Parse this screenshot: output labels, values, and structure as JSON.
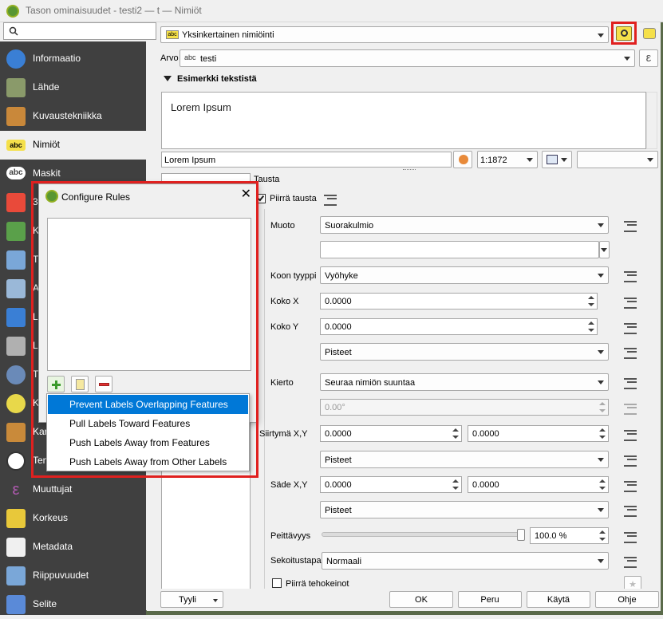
{
  "window": {
    "title": "Tason ominaisuudet - testi2 — t — Nimiöt"
  },
  "search": {
    "placeholder": ""
  },
  "sidebar": {
    "items": [
      {
        "label": "Informaatio",
        "icon": "info-icon"
      },
      {
        "label": "Lähde",
        "icon": "source-icon"
      },
      {
        "label": "Kuvaustekniikka",
        "icon": "symbology-icon"
      },
      {
        "label": "Nimiöt",
        "icon": "labels-icon"
      },
      {
        "label": "Maskit",
        "icon": "masks-icon"
      },
      {
        "label": "3",
        "icon": "3d-view-icon"
      },
      {
        "label": "K",
        "icon": "diagrams-icon"
      },
      {
        "label": "T",
        "icon": "fields-icon"
      },
      {
        "label": "A",
        "icon": "attributes-form-icon"
      },
      {
        "label": "L",
        "icon": "joins-icon"
      },
      {
        "label": "L",
        "icon": "auxiliary-storage-icon"
      },
      {
        "label": "T",
        "icon": "actions-icon"
      },
      {
        "label": "K",
        "icon": "display-icon"
      },
      {
        "label": "Kar",
        "icon": "rendering-icon"
      },
      {
        "label": "Ten",
        "icon": "temporal-icon"
      },
      {
        "label": "Muuttujat",
        "icon": "variables-icon"
      },
      {
        "label": "Korkeus",
        "icon": "elevation-icon"
      },
      {
        "label": "Metadata",
        "icon": "metadata-icon"
      },
      {
        "label": "Riippuvuudet",
        "icon": "dependencies-icon"
      },
      {
        "label": "Selite",
        "icon": "legend-icon"
      }
    ]
  },
  "labeling": {
    "mode": "Yksinkertainen nimiöinti",
    "mode_badge": "abc",
    "value_label": "Arvo",
    "value_badge": "abc",
    "value_field": "testi",
    "expression_symbol": "ε"
  },
  "preview": {
    "section_title": "Esimerkki tekstistä",
    "sample_text": "Lorem Ipsum",
    "sample_input": "Lorem Ipsum",
    "scale": "1:1872"
  },
  "background": {
    "section": "Tausta",
    "draw_label": "Piirrä tausta",
    "draw_checked": true,
    "shape_label": "Muoto",
    "shape_value": "Suorakulmio",
    "size_type_label": "Koon tyyppi",
    "size_type_value": "Vyöhyke",
    "size_x_label": "Koko X",
    "size_x_value": "0.0000",
    "size_y_label": "Koko Y",
    "size_y_value": "0.0000",
    "size_unit": "Pisteet",
    "rotation_label": "Kierto",
    "rotation_value": "Seuraa nimiön suuntaa",
    "rotation_angle": "0.00°",
    "offset_label": "Siirtymä X,Y",
    "offset_x": "0.0000",
    "offset_y": "0.0000",
    "offset_unit": "Pisteet",
    "radius_label": "Säde X,Y",
    "radius_x": "0.0000",
    "radius_y": "0.0000",
    "radius_unit": "Pisteet",
    "opacity_label": "Peittävyys",
    "opacity_value": "100.0 %",
    "opacity_fraction": 1.0,
    "blend_label": "Sekoitustapa",
    "blend_value": "Normaali",
    "effects_label": "Piirrä tehokeinot",
    "effects_checked": false
  },
  "dialog": {
    "title": "Configure Rules",
    "menu": [
      "Prevent Labels Overlapping Features",
      "Pull Labels Toward Features",
      "Push Labels Away from Features",
      "Push Labels Away from Other Labels"
    ],
    "selected_index": 0
  },
  "footer": {
    "style_label": "Tyyli",
    "ok_label": "OK",
    "cancel_label": "Peru",
    "apply_label": "Käytä",
    "help_label": "Ohje"
  },
  "colors": {
    "sidebar": "#404040",
    "highlight": "#e0201f",
    "selection": "#0078d7"
  }
}
